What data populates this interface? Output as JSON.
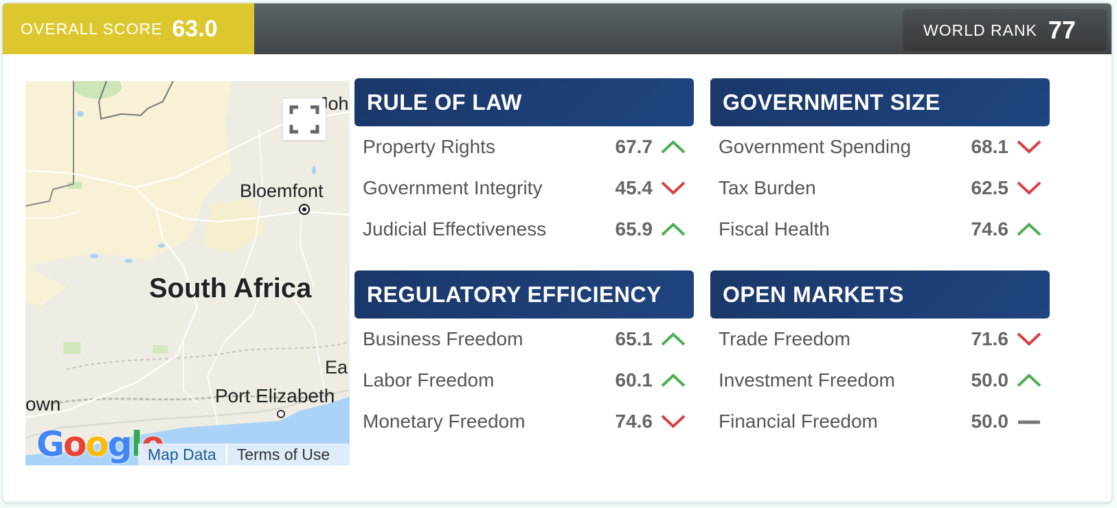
{
  "header": {
    "overall_score_label": "Overall Score",
    "overall_score": "63.0",
    "world_rank_label": "WORLD RANK",
    "world_rank": "77"
  },
  "map": {
    "country_label": "South Africa",
    "cities": [
      "Bloemfontein",
      "Port Elizabeth",
      "Johannesburg",
      "East London",
      "Cape Town"
    ],
    "visible_city_text": {
      "bloemfontein": "Bloemfont",
      "port_elizabeth": "Port Elizabeth",
      "johannesburg": "Joh",
      "east_london": "Ea",
      "cape_town": "own"
    },
    "google_logo": [
      "G",
      "o",
      "o",
      "g",
      "l",
      "e"
    ],
    "map_data_link": "Map Data",
    "terms_link": "Terms of Use",
    "fullscreen_icon": "fullscreen-icon"
  },
  "colors": {
    "score_bg": "#dcc72e",
    "header_bg": "#1c3d74",
    "trend_up": "#4caf50",
    "trend_down": "#d94141",
    "trend_flat": "#777777"
  },
  "panels": [
    {
      "title": "RULE OF LAW",
      "items": [
        {
          "label": "Property Rights",
          "value": "67.7",
          "trend": "up"
        },
        {
          "label": "Government Integrity",
          "value": "45.4",
          "trend": "down"
        },
        {
          "label": "Judicial Effectiveness",
          "value": "65.9",
          "trend": "up"
        }
      ]
    },
    {
      "title": "GOVERNMENT SIZE",
      "items": [
        {
          "label": "Government Spending",
          "value": "68.1",
          "trend": "down"
        },
        {
          "label": "Tax Burden",
          "value": "62.5",
          "trend": "down"
        },
        {
          "label": "Fiscal Health",
          "value": "74.6",
          "trend": "up"
        }
      ]
    },
    {
      "title": "REGULATORY EFFICIENCY",
      "items": [
        {
          "label": "Business Freedom",
          "value": "65.1",
          "trend": "up"
        },
        {
          "label": "Labor Freedom",
          "value": "60.1",
          "trend": "up"
        },
        {
          "label": "Monetary Freedom",
          "value": "74.6",
          "trend": "down"
        }
      ]
    },
    {
      "title": "OPEN MARKETS",
      "items": [
        {
          "label": "Trade Freedom",
          "value": "71.6",
          "trend": "down"
        },
        {
          "label": "Investment Freedom",
          "value": "50.0",
          "trend": "up"
        },
        {
          "label": "Financial Freedom",
          "value": "50.0",
          "trend": "flat"
        }
      ]
    }
  ]
}
